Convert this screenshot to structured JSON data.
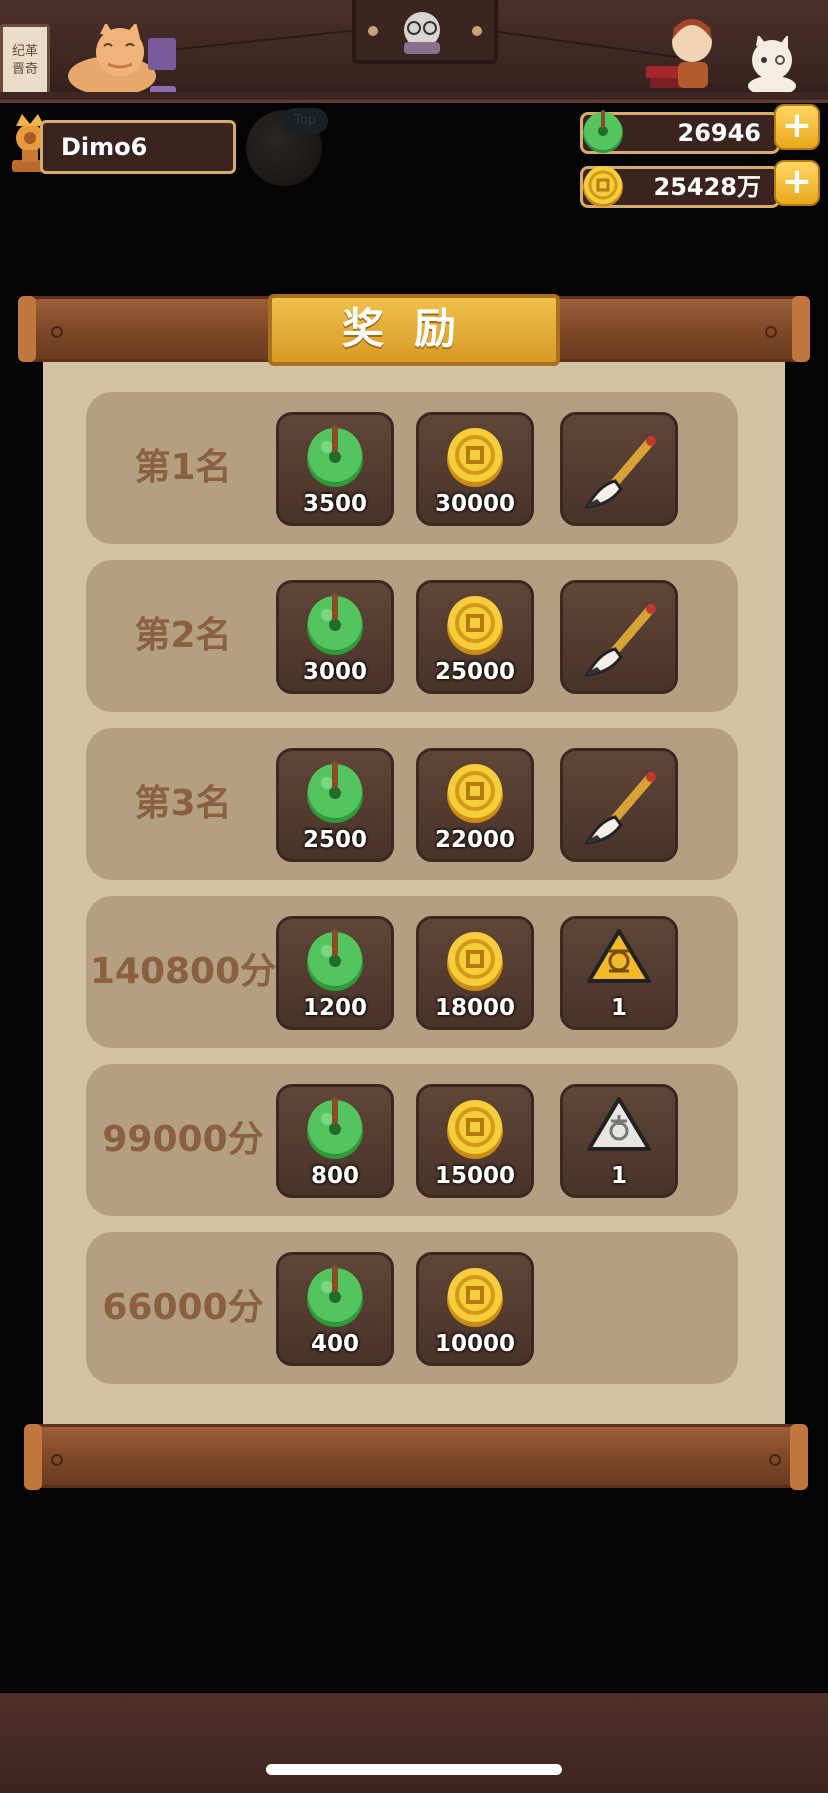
{
  "header": {
    "player_name": "Dimo6",
    "ghost_badge": "Top",
    "jade_amount": "26946",
    "gold_amount": "25428万",
    "plus_label": "+",
    "sign_text": "纪革\n晋奇"
  },
  "panel": {
    "title": "奖励",
    "rows": [
      {
        "label": "第1名",
        "jade": "3500",
        "gold": "30000",
        "extra_icon": "brush-icon",
        "extra_amount": ""
      },
      {
        "label": "第2名",
        "jade": "3000",
        "gold": "25000",
        "extra_icon": "brush-icon",
        "extra_amount": ""
      },
      {
        "label": "第3名",
        "jade": "2500",
        "gold": "22000",
        "extra_icon": "brush-icon",
        "extra_amount": ""
      },
      {
        "label": "140800分",
        "jade": "1200",
        "gold": "18000",
        "extra_icon": "gold-charm-icon",
        "extra_amount": "1"
      },
      {
        "label": "99000分",
        "jade": "800",
        "gold": "15000",
        "extra_icon": "silver-charm-icon",
        "extra_amount": "1"
      },
      {
        "label": "66000分",
        "jade": "400",
        "gold": "10000",
        "extra_icon": "",
        "extra_amount": ""
      }
    ]
  },
  "colors": {
    "jade": "#39b54a",
    "gold": "#f2c230",
    "row_bg": "#b49f82",
    "label": "#8b6041"
  }
}
